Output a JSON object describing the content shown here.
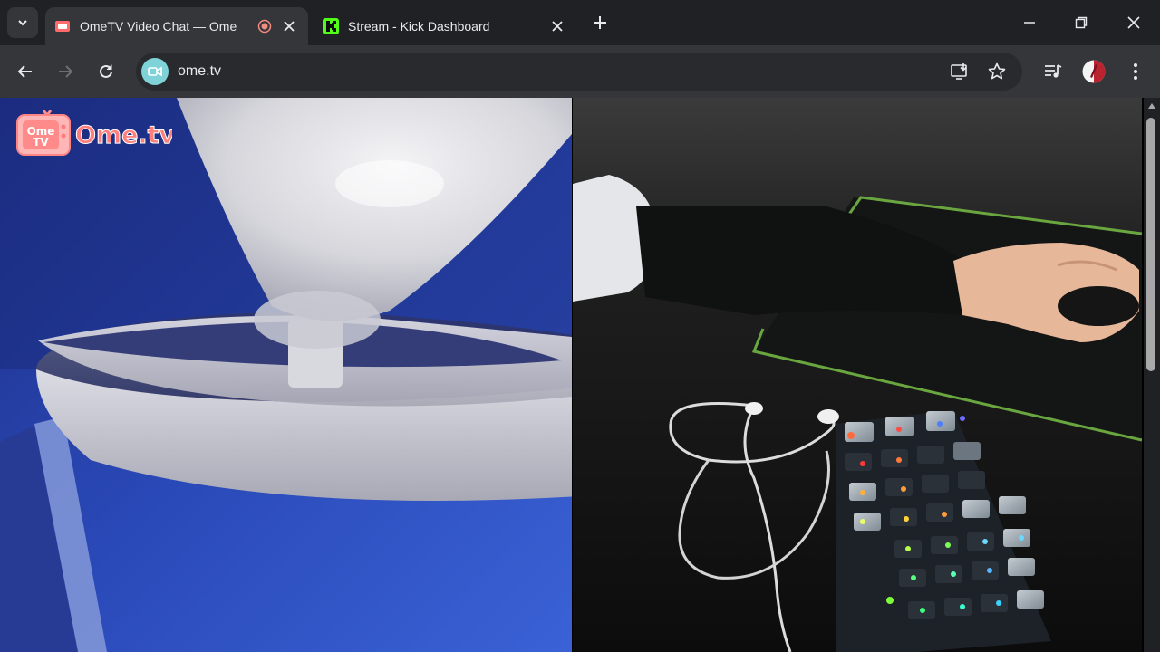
{
  "tabs": [
    {
      "title": "OmeTV Video Chat — Ome",
      "active": true,
      "recording": true
    },
    {
      "title": "Stream - Kick Dashboard",
      "active": false
    }
  ],
  "address_bar": {
    "url": "ome.tv"
  },
  "video": {
    "logo_box_text": "Ome",
    "logo_box_subtext": "TV",
    "logo_text": "Ome.tv"
  },
  "colors": {
    "chrome_dark": "#202124",
    "toolbar": "#35363a",
    "omnibox": "#282a2d",
    "kick_green": "#53fc18",
    "ometv_red": "#ff6b6b"
  },
  "icons": [
    "tab-search-icon",
    "close-icon",
    "record-icon",
    "plus-icon",
    "minimize-icon",
    "restore-icon",
    "back-arrow-icon",
    "forward-arrow-icon",
    "reload-icon",
    "install-app-icon",
    "star-icon",
    "media-control-icon",
    "profile-avatar",
    "more-vert-icon"
  ]
}
